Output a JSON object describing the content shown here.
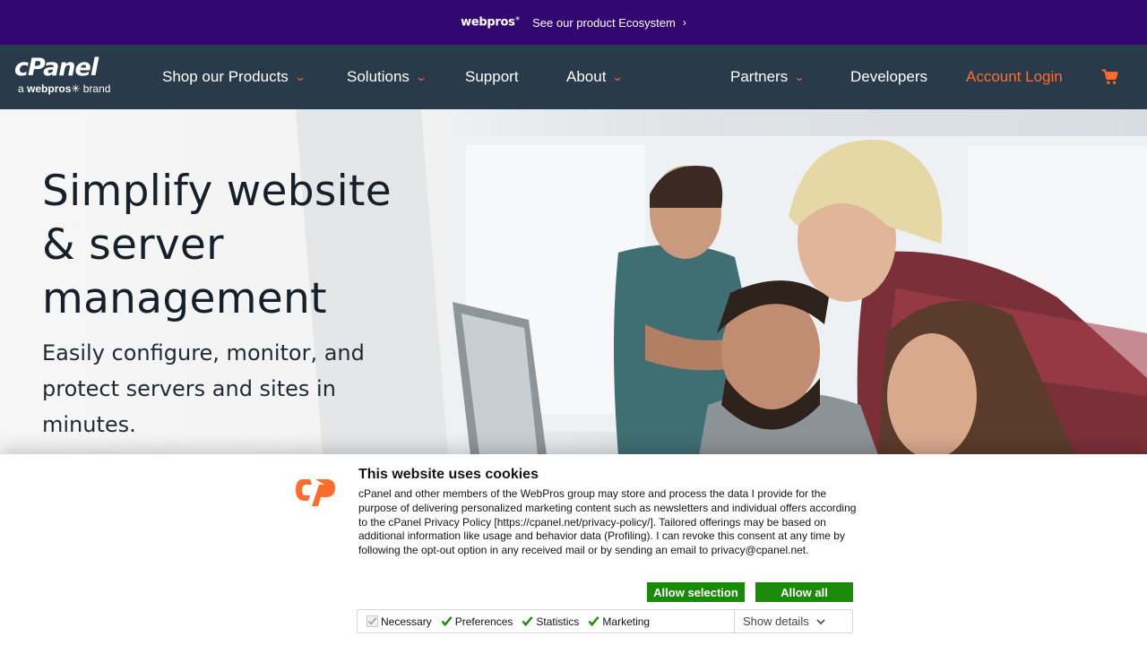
{
  "ecobar": {
    "logo": "webpros",
    "link": "See our product Ecosystem"
  },
  "nav": {
    "brand": "cPanel",
    "brand_sub_prefix": "a",
    "brand_sub_company": "webpros",
    "brand_sub_suffix": "brand",
    "items": [
      {
        "label": "Shop our Products",
        "has_dropdown": true
      },
      {
        "label": "Solutions",
        "has_dropdown": true
      },
      {
        "label": "Support",
        "has_dropdown": false
      },
      {
        "label": "About",
        "has_dropdown": true
      },
      {
        "label": "Partners",
        "has_dropdown": true
      },
      {
        "label": "Developers",
        "has_dropdown": false
      },
      {
        "label": "Account Login",
        "has_dropdown": false
      }
    ],
    "cart_icon": "shopping-cart-icon"
  },
  "hero": {
    "title": "Simplify website & server management",
    "subtitle": "Easily configure, monitor, and protect servers and sites in minutes."
  },
  "cookie": {
    "title": "This website uses cookies",
    "text": "cPanel and other members of the WebPros group may store and process the data I provide for the purpose of delivering personalized marketing content such as newsletters and individual offers according to the cPanel Privacy Policy [https://cpanel.net/privacy-policy/]. Tailored offerings may be based on additional information like usage and behavior data (Profiling). I can revoke this consent at any time by following the opt-out option in any received mail or by sending an email to privacy@cpanel.net.",
    "allow_selection": "Allow selection",
    "allow_all": "Allow all",
    "options": [
      {
        "label": "Necessary",
        "checked": true,
        "disabled": true
      },
      {
        "label": "Preferences",
        "checked": true,
        "disabled": false
      },
      {
        "label": "Statistics",
        "checked": true,
        "disabled": false
      },
      {
        "label": "Marketing",
        "checked": true,
        "disabled": false
      }
    ],
    "show_details": "Show details"
  },
  "colors": {
    "eco_bar": "#32076f",
    "nav_bg": "#293a4a",
    "accent": "#ff6c2c",
    "button_green": "#1a8b08"
  }
}
